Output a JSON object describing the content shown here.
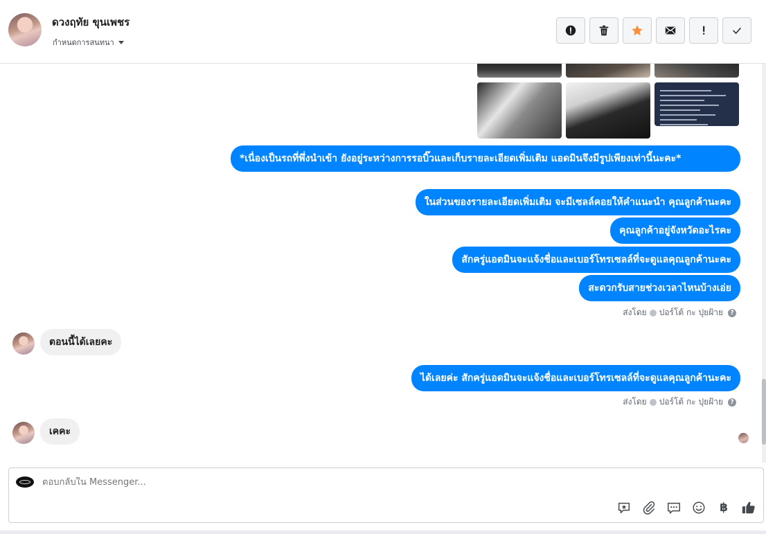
{
  "header": {
    "contact_name": "ดวงฤทัย ขุนเพชร",
    "assign_label": "กำหนดการสนทนา",
    "actions": [
      "spam-icon",
      "trash-icon",
      "star-icon",
      "mail-icon",
      "important-icon",
      "check-icon"
    ],
    "star_color": "#f7923a"
  },
  "messages": [
    {
      "text": "*เนื่องเป็นรถที่พึ่งนำเข้า ยังอยู่ระหว่างการรอบิ๊วและเก็บรายละเอียดเพิ่มเติม แอดมินจึงมีรูปเพียงเท่านี้นะคะ*"
    },
    {
      "text": "ในส่วนของรายละเอียดเพิ่มเติม จะมีเซลล์คอยให้คำแนะนำ คุณลูกค้านะคะ"
    },
    {
      "text": "คุณลูกค้าอยู่จังหวัดอะไรคะ"
    },
    {
      "text": "สักครู่แอดมินจะแจ้งชื่อและเบอร์โทรเซลล์ที่จะดูแลคุณลูกค้านะคะ"
    },
    {
      "text": "สะดวกรับสายช่วงเวลาไหนบ้างเอ่ย"
    },
    {
      "text": "ตอนนี้ได้เลยคะ"
    },
    {
      "text": "ได้เลยค่ะ สักครู่แอดมินจะแจ้งชื่อและเบอร์โทรเซลล์ที่จะดูแลคุณลูกค้านะคะ"
    },
    {
      "text": "เคคะ"
    }
  ],
  "sent_by_label": "ส่งโดย",
  "sender_name": "ปอร์โต้ กะ ปุยฝ้าย",
  "composer": {
    "placeholder": "ตอบกลับใน Messenger...",
    "baht_symbol": "฿"
  },
  "colors": {
    "outgoing_bubble": "#0084ff",
    "incoming_bubble": "#f1f0f0"
  }
}
